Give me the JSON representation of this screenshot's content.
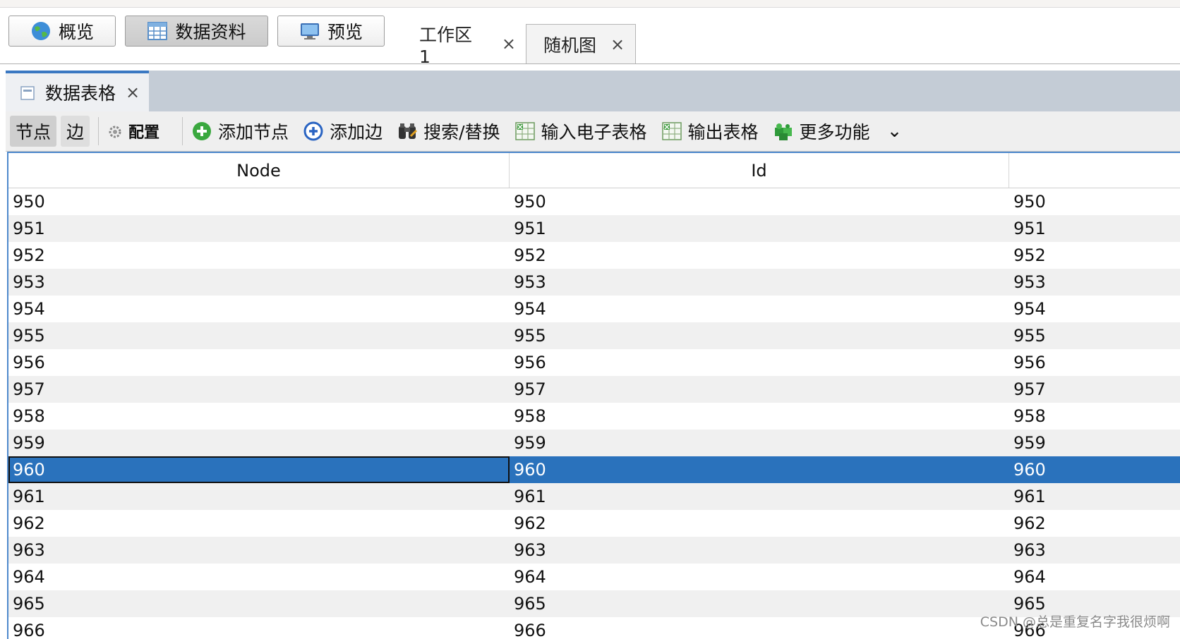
{
  "mode_buttons": [
    {
      "label": "概览",
      "icon": "globe-icon"
    },
    {
      "label": "数据资料",
      "icon": "table-icon"
    },
    {
      "label": "预览",
      "icon": "monitor-icon"
    }
  ],
  "workspace_tabs": [
    {
      "label": "工作区 1",
      "close": "×"
    },
    {
      "label": "随机图",
      "close": "×"
    }
  ],
  "panel": {
    "title": "数据表格",
    "close": "×",
    "icon": "table-icon"
  },
  "toolbar": {
    "nodes_toggle": "节点",
    "edges_toggle": "边",
    "config": "配置",
    "add_node": "添加节点",
    "add_edge": "添加边",
    "search_replace": "搜索/替换",
    "import_spreadsheet": "输入电子表格",
    "export_table": "输出表格",
    "more_functions": "更多功能",
    "more_chevron": "⌄"
  },
  "table": {
    "columns": [
      "Node",
      "Id",
      ""
    ],
    "rows": [
      [
        "950",
        "950",
        "950"
      ],
      [
        "951",
        "951",
        "951"
      ],
      [
        "952",
        "952",
        "952"
      ],
      [
        "953",
        "953",
        "953"
      ],
      [
        "954",
        "954",
        "954"
      ],
      [
        "955",
        "955",
        "955"
      ],
      [
        "956",
        "956",
        "956"
      ],
      [
        "957",
        "957",
        "957"
      ],
      [
        "958",
        "958",
        "958"
      ],
      [
        "959",
        "959",
        "959"
      ],
      [
        "960",
        "960",
        "960"
      ],
      [
        "961",
        "961",
        "961"
      ],
      [
        "962",
        "962",
        "962"
      ],
      [
        "963",
        "963",
        "963"
      ],
      [
        "964",
        "964",
        "964"
      ],
      [
        "965",
        "965",
        "965"
      ],
      [
        "966",
        "966",
        "966"
      ]
    ],
    "selected_row_index": 10
  },
  "watermark": "CSDN @总是重复名字我很烦啊",
  "colors": {
    "selection": "#2a72bc",
    "panel_bar": "#c4ccd6",
    "active_tab_accent": "#3a78c2"
  }
}
